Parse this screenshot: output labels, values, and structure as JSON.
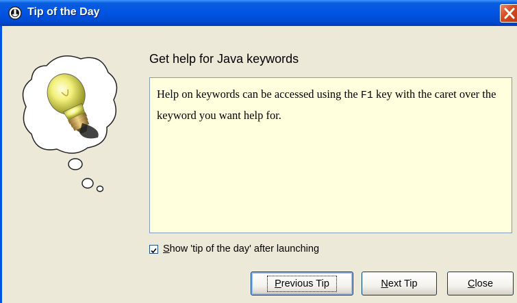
{
  "window": {
    "title": "Tip of the Day",
    "close_button": "close"
  },
  "tip": {
    "heading": "Get help for Java keywords",
    "text_part1": "Help on keywords can be accessed using the ",
    "text_key": "F1",
    "text_part2": " key with the caret over the keyword you want help for."
  },
  "options": {
    "show_tips_label_mnemonic": "S",
    "show_tips_label_rest": "how 'tip of the day' after launching",
    "show_tips_checked": true
  },
  "buttons": {
    "previous_mnemonic": "P",
    "previous_rest": "revious Tip",
    "next_mnemonic": "N",
    "next_rest": "ext Tip",
    "close_mnemonic": "C",
    "close_rest": "lose"
  },
  "colors": {
    "titlebar": "#0054e3",
    "dialog_bg": "#ece9d8",
    "tip_bg": "#ffffdd",
    "close_red": "#d44a1f"
  },
  "icons": {
    "title_icon": "jdev-app-icon",
    "illustration": "lightbulb-thought-cloud-icon"
  }
}
